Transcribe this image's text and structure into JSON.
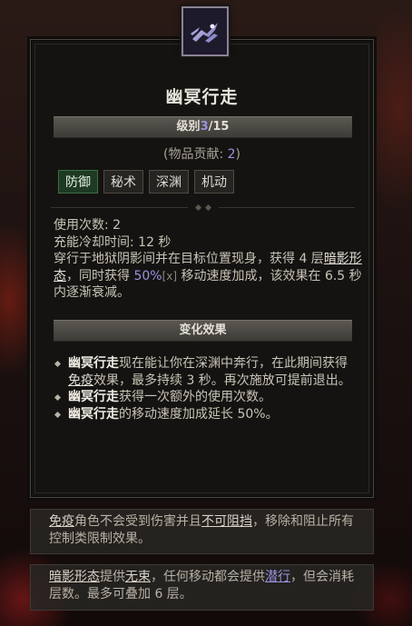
{
  "skill": {
    "title": "幽冥行走",
    "rank_label": "级别",
    "rank_current": "3",
    "rank_max": "/15",
    "contrib_prefix": "(物品贡献: ",
    "contrib_value": "2",
    "contrib_suffix": ")",
    "tags": [
      "防御",
      "秘术",
      "深渊",
      "机动"
    ],
    "icon": "shadow-step-icon"
  },
  "stats": {
    "charges_label": "使用次数: 2",
    "cooldown_label": "充能冷却时间: 12 秒",
    "desc_part1": "穿行于地狱阴影间并在目标位置现身，获得 4 层",
    "desc_keyword": "暗影形态",
    "desc_part2": "，同时获得 ",
    "desc_value": "50%",
    "desc_scale": "[x]",
    "desc_part3": " 移动速度加成，该效果在 6.5 秒内逐渐衰减。"
  },
  "modifiers": {
    "header": "变化效果",
    "items": [
      {
        "bold": "幽冥行走",
        "text1": "现在能让你在深渊中奔行，在此期间获得",
        "keyword": "免疫",
        "text2": "效果，最多持续 3 秒。再次施放可提前退出。"
      },
      {
        "bold": "幽冥行走",
        "text1": "获得一次额外的使用次数。",
        "keyword": "",
        "text2": ""
      },
      {
        "bold": "幽冥行走",
        "text1": "的移动速度加成延长 50%。",
        "keyword": "",
        "text2": ""
      }
    ]
  },
  "glossary": {
    "immune_term": "免疫",
    "immune_text1": "角色不会受到伤害并且",
    "immune_term2": "不可阻挡",
    "immune_text2": "，移除和阻止所有控制类限制效果。",
    "shadow_term": "暗影形态",
    "shadow_text1": "提供",
    "shadow_term2": "无束",
    "shadow_text2": "，任何移动都会提供",
    "shadow_term3": "潜行",
    "shadow_text3": "，但会消耗层数。最多可叠加 6 层。"
  },
  "colors": {
    "accent_purple": "#9a92e0",
    "active_tag": "#1e3a22"
  }
}
